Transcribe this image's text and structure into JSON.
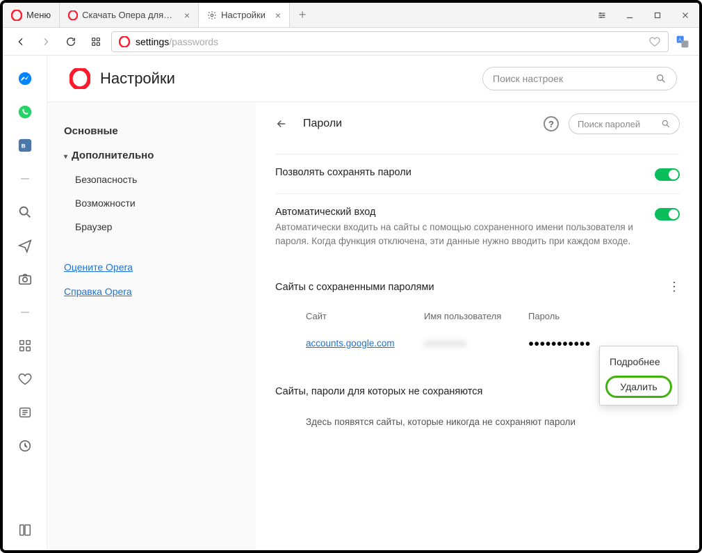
{
  "menu_label": "Меню",
  "tabs": [
    {
      "label": "Скачать Опера для комп..."
    },
    {
      "label": "Настройки"
    }
  ],
  "address": {
    "scheme": "settings",
    "path": "/passwords"
  },
  "settings_title": "Настройки",
  "settings_search_placeholder": "Поиск настроек",
  "nav": {
    "basic": "Основные",
    "advanced": "Дополнительно",
    "security": "Безопасность",
    "features": "Возможности",
    "browser": "Браузер",
    "rate": "Оцените Opera",
    "help": "Справка Opera"
  },
  "panel": {
    "title": "Пароли",
    "pwd_search_placeholder": "Поиск паролей",
    "allow_save_label": "Позволять сохранять пароли",
    "auto_login_title": "Автоматический вход",
    "auto_login_desc": "Автоматически входить на сайты с помощью сохраненного имени пользователя и пароля. Когда функция отключена, эти данные нужно вводить при каждом входе.",
    "saved_sites_title": "Сайты с сохраненными паролями",
    "col_site": "Сайт",
    "col_user": "Имя пользователя",
    "col_pwd": "Пароль",
    "row_site": "accounts.google.com",
    "row_user_blurred": "xxxxxxxxx",
    "row_pwd_dots": "●●●●●●●●●●●",
    "never_sites_title": "Сайты, пароли для которых не сохраняются",
    "never_sites_empty": "Здесь появятся сайты, которые никогда не сохраняют пароли",
    "ctx_details": "Подробнее",
    "ctx_delete": "Удалить"
  }
}
